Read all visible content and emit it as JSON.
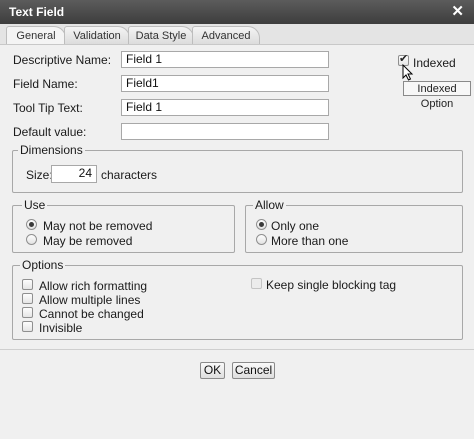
{
  "window": {
    "title": "Text Field",
    "close_glyph": "✕"
  },
  "tabs": [
    "General",
    "Validation",
    "Data Style",
    "Advanced"
  ],
  "fields": {
    "descriptive_name": {
      "label": "Descriptive Name:",
      "value": "Field 1"
    },
    "field_name": {
      "label": "Field Name:",
      "value": "Field1"
    },
    "tooltip_text": {
      "label": "Tool Tip Text:",
      "value": "Field 1"
    },
    "default_value": {
      "label": "Default value:",
      "value": ""
    }
  },
  "indexed": {
    "label": "Indexed",
    "checked": true,
    "tooltip": "Indexed Option"
  },
  "dimensions": {
    "legend": "Dimensions",
    "size_label": "Size:",
    "size_value": "24",
    "unit": "characters"
  },
  "use": {
    "legend": "Use",
    "options": [
      "May not be removed",
      "May be removed"
    ],
    "selected": "May not be removed"
  },
  "allow": {
    "legend": "Allow",
    "options": [
      "Only one",
      "More than one"
    ],
    "selected": "Only one"
  },
  "options": {
    "legend": "Options",
    "allow_rich": "Allow rich formatting",
    "allow_multiple": "Allow multiple lines",
    "cannot_change": "Cannot be changed",
    "invisible": "Invisible",
    "keep_single": "Keep single blocking tag"
  },
  "buttons": {
    "ok": "OK",
    "cancel": "Cancel"
  }
}
